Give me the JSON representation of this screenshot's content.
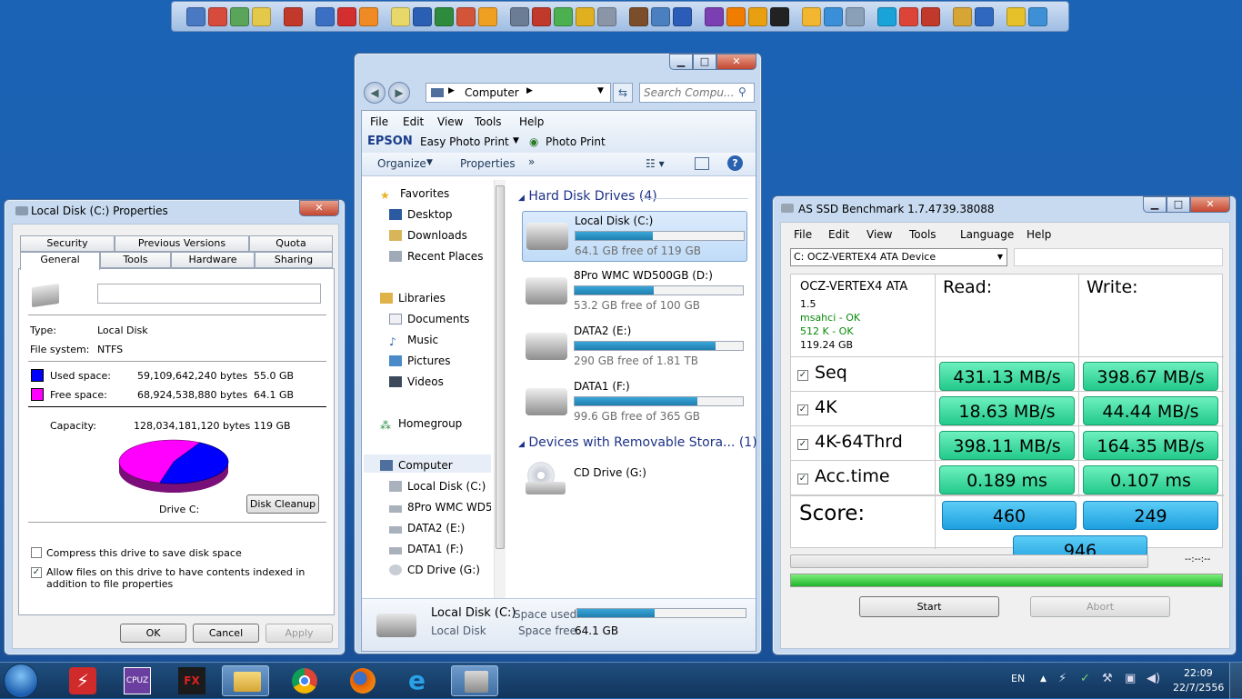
{
  "dock": {
    "icons": [
      "monitor-icon",
      "network-icon",
      "tools-icon",
      "linux-icon",
      "dictionary-icon",
      "card-icon",
      "pdf-icon",
      "image-viewer-icon",
      "notes-icon",
      "word-icon",
      "excel-icon",
      "powerpoint-icon",
      "office-icon",
      "settings-icon",
      "drive-red-icon",
      "drive-green-icon",
      "drive-yellow-icon",
      "drive-gray-icon",
      "tiki-icon",
      "gallery-icon",
      "media-player-icon",
      "visual-studio-icon",
      "vlc-icon",
      "winamp-icon",
      "camera-icon",
      "sun-icon",
      "bird-icon",
      "gear-icon",
      "skype-icon",
      "chrome-icon",
      "record-icon",
      "folder-icon",
      "play-icon",
      "star-icon",
      "safari-icon"
    ]
  },
  "properties": {
    "title": "Local Disk (C:) Properties",
    "tabs_row1": [
      "Security",
      "Previous Versions",
      "Quota"
    ],
    "tabs_row2": [
      "General",
      "Tools",
      "Hardware",
      "Sharing"
    ],
    "name_value": "",
    "type_label": "Type:",
    "type_value": "Local Disk",
    "fs_label": "File system:",
    "fs_value": "NTFS",
    "used_label": "Used space:",
    "used_bytes": "59,109,642,240 bytes",
    "used_gb": "55.0 GB",
    "free_label": "Free space:",
    "free_bytes": "68,924,538,880 bytes",
    "free_gb": "64.1 GB",
    "cap_label": "Capacity:",
    "cap_bytes": "128,034,181,120 bytes",
    "cap_gb": "119 GB",
    "drive_label": "Drive C:",
    "cleanup": "Disk Cleanup",
    "compress": "Compress this drive to save disk space",
    "index": "Allow files on this drive to have contents indexed in addition to file properties",
    "ok": "OK",
    "cancel": "Cancel",
    "apply": "Apply",
    "used_color": "#0000ff",
    "free_color": "#ff00ff"
  },
  "explorer": {
    "address": "Computer",
    "search_placeholder": "Search Compu...",
    "menu": [
      "File",
      "Edit",
      "View",
      "Tools",
      "Help"
    ],
    "epson": "EPSON",
    "easy_photo": "Easy Photo Print",
    "photo_print": "Photo Print",
    "organize": "Organize",
    "properties": "Properties",
    "more": "»",
    "nav": {
      "favorites": "Favorites",
      "desktop": "Desktop",
      "downloads": "Downloads",
      "recent": "Recent Places",
      "libraries": "Libraries",
      "documents": "Documents",
      "music": "Music",
      "pictures": "Pictures",
      "videos": "Videos",
      "homegroup": "Homegroup",
      "computer": "Computer",
      "c": "Local Disk (C:)",
      "d": "8Pro WMC WD5",
      "e": "DATA2 (E:)",
      "f": "DATA1 (F:)",
      "g": "CD Drive (G:)"
    },
    "hdd_header": "Hard Disk Drives (4)",
    "removable_header": "Devices with Removable Stora... (1)",
    "drives": [
      {
        "name": "Local Disk (C:)",
        "free": "64.1 GB free of 119 GB",
        "used_fraction": 0.46
      },
      {
        "name": "8Pro WMC WD500GB (D:)",
        "free": "53.2 GB free of 100 GB",
        "used_fraction": 0.47
      },
      {
        "name": "DATA2 (E:)",
        "free": "290 GB free of 1.81 TB",
        "used_fraction": 0.84
      },
      {
        "name": "DATA1 (F:)",
        "free": "99.6 GB free of 365 GB",
        "used_fraction": 0.73
      }
    ],
    "cd": "CD Drive (G:)",
    "details": {
      "name": "Local Disk (C:)",
      "type": "Local Disk",
      "space_used_label": "Space used:",
      "space_free_label": "Space free:",
      "space_free": "64.1 GB",
      "used_fraction": 0.46
    }
  },
  "bench": {
    "title": "AS SSD Benchmark 1.7.4739.38088",
    "menu": [
      "File",
      "Edit",
      "View",
      "Tools",
      "Language",
      "Help"
    ],
    "device": "C: OCZ-VERTEX4 ATA Device",
    "info": {
      "model": "OCZ-VERTEX4 ATA",
      "fw": "1.5",
      "driver": "msahci - OK",
      "align": "512 K - OK",
      "size": "119.24 GB"
    },
    "read_label": "Read:",
    "write_label": "Write:",
    "rows": [
      {
        "label": "Seq",
        "read": "431.13 MB/s",
        "write": "398.67 MB/s"
      },
      {
        "label": "4K",
        "read": "18.63 MB/s",
        "write": "44.44 MB/s"
      },
      {
        "label": "4K-64Thrd",
        "read": "398.11 MB/s",
        "write": "164.35 MB/s"
      },
      {
        "label": "Acc.time",
        "read": "0.189 ms",
        "write": "0.107 ms"
      }
    ],
    "score_label": "Score:",
    "score_read": "460",
    "score_write": "249",
    "score_total": "946",
    "time": "--:--:--",
    "start": "Start",
    "abort": "Abort",
    "progress": 1.0
  },
  "taskbar": {
    "lang": "EN",
    "time": "22:09",
    "date": "22/7/2556"
  }
}
